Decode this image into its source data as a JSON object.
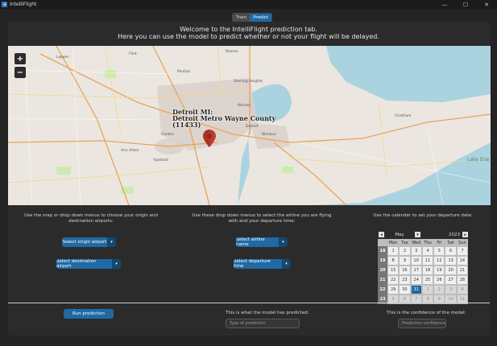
{
  "window": {
    "title": "IntelliFlight",
    "minimize": "—",
    "maximize": "☐",
    "close": "✕"
  },
  "tabs": [
    {
      "label": "Train"
    },
    {
      "label": "Predict"
    }
  ],
  "welcome": {
    "line1": "Welcome to the IntelliFlight prediction tab.",
    "line2": "Here you can use the model to predict whether or not your flight will be delayed."
  },
  "map": {
    "zoom_in": "+",
    "zoom_out": "−",
    "marker_label": "Detroit MI:\nDetroit Metro Wayne County\n(11433)",
    "places": [
      "Pontiac",
      "Sterling Heights",
      "Warren",
      "Detroit",
      "Windsor",
      "Ann Arbor",
      "Canton",
      "Ypsilanti",
      "Chatham",
      "Lake Erie",
      "Flint",
      "Romeo",
      "Lapeer"
    ]
  },
  "airports": {
    "instructions": "Use the map or drop down menus to choose your origin and destination airports:",
    "origin_label": "Select origin airport",
    "destination_label": "Select destination airport"
  },
  "airline": {
    "instructions": "Use these drop down menus to select the airline you are flying with and your departure time:",
    "airline_label": "Select airline name",
    "time_label": "Select departure time"
  },
  "calendar": {
    "instructions": "Use the calender to set your departure date:",
    "month": "May",
    "year": "2023",
    "prev": "◂",
    "next": "▸",
    "month_dd": "▾",
    "days_of_week": [
      "Mon",
      "Tue",
      "Wed",
      "Thu",
      "Fri",
      "Sat",
      "Sun"
    ],
    "weeks": [
      {
        "num": "18",
        "days": [
          [
            "1",
            ""
          ],
          [
            "2",
            ""
          ],
          [
            "3",
            ""
          ],
          [
            "4",
            ""
          ],
          [
            "5",
            ""
          ],
          [
            "6",
            ""
          ],
          [
            "7",
            ""
          ]
        ]
      },
      {
        "num": "19",
        "days": [
          [
            "8",
            ""
          ],
          [
            "9",
            ""
          ],
          [
            "10",
            ""
          ],
          [
            "11",
            ""
          ],
          [
            "12",
            ""
          ],
          [
            "13",
            ""
          ],
          [
            "14",
            ""
          ]
        ]
      },
      {
        "num": "20",
        "days": [
          [
            "15",
            ""
          ],
          [
            "16",
            ""
          ],
          [
            "17",
            ""
          ],
          [
            "18",
            ""
          ],
          [
            "19",
            ""
          ],
          [
            "20",
            ""
          ],
          [
            "21",
            ""
          ]
        ]
      },
      {
        "num": "21",
        "days": [
          [
            "22",
            ""
          ],
          [
            "23",
            ""
          ],
          [
            "24",
            ""
          ],
          [
            "25",
            ""
          ],
          [
            "26",
            ""
          ],
          [
            "27",
            ""
          ],
          [
            "28",
            ""
          ]
        ]
      },
      {
        "num": "22",
        "days": [
          [
            "29",
            ""
          ],
          [
            "30",
            ""
          ],
          [
            "31",
            "sel"
          ],
          [
            "1",
            "other"
          ],
          [
            "2",
            "other"
          ],
          [
            "3",
            "other"
          ],
          [
            "4",
            "other"
          ]
        ]
      },
      {
        "num": "23",
        "days": [
          [
            "5",
            "other"
          ],
          [
            "6",
            "other"
          ],
          [
            "7",
            "other"
          ],
          [
            "8",
            "other"
          ],
          [
            "9",
            "other"
          ],
          [
            "10",
            "other"
          ],
          [
            "11",
            "other"
          ]
        ]
      }
    ]
  },
  "prediction": {
    "run_label": "Run prediction",
    "result_caption": "This is what the model has predicted:",
    "result_placeholder": "Type of prediction",
    "confidence_caption": "This is the confidence of the model:",
    "confidence_placeholder": "Prediction confidence"
  },
  "colors": {
    "accent": "#1f6aa5",
    "background": "#242424",
    "panel": "#2b2b2b",
    "marker": "#c0392b"
  }
}
